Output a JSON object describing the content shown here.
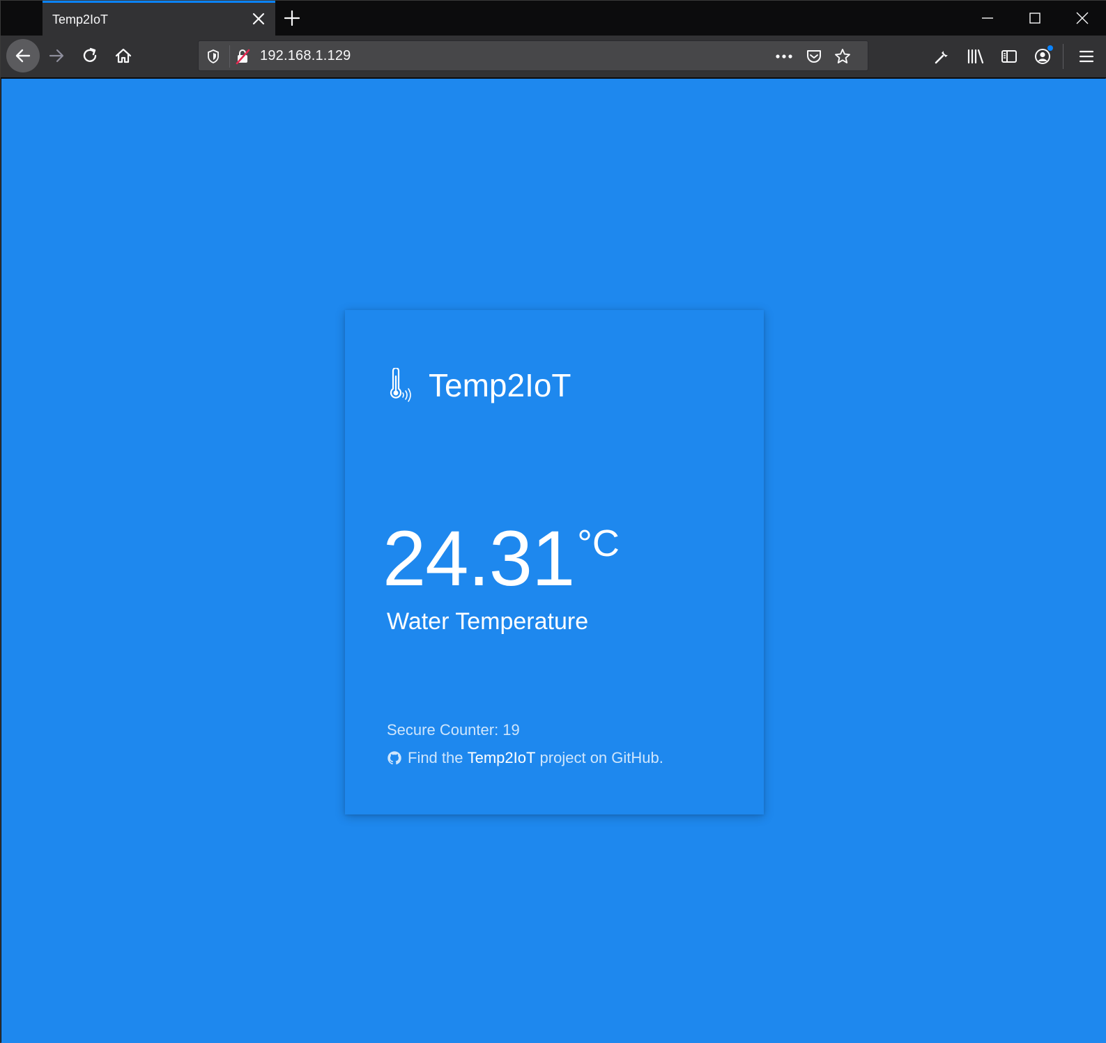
{
  "browser": {
    "tab_title": "Temp2IoT",
    "url": "192.168.1.129"
  },
  "page": {
    "brand_name": "Temp2IoT",
    "temperature_value": "24.31",
    "temperature_unit": "°C",
    "temperature_label": "Water Temperature",
    "secure_counter": "Secure Counter: 19",
    "github_prefix": "Find the ",
    "github_link": "Temp2IoT",
    "github_suffix": " project on GitHub."
  },
  "colors": {
    "page_background": "#1e88ee",
    "tab_accent": "#0a84ff",
    "toolbar": "#323234",
    "urlbar": "#474749"
  },
  "icons": [
    "close-icon",
    "plus-icon",
    "minimize-icon",
    "maximize-icon",
    "back-icon",
    "forward-icon",
    "reload-icon",
    "home-icon",
    "shield-icon",
    "insecure-lock-icon",
    "more-icon",
    "pocket-icon",
    "star-icon",
    "wrench-icon",
    "library-icon",
    "sidebar-icon",
    "account-icon",
    "menu-icon",
    "thermometer-icon",
    "github-icon"
  ]
}
